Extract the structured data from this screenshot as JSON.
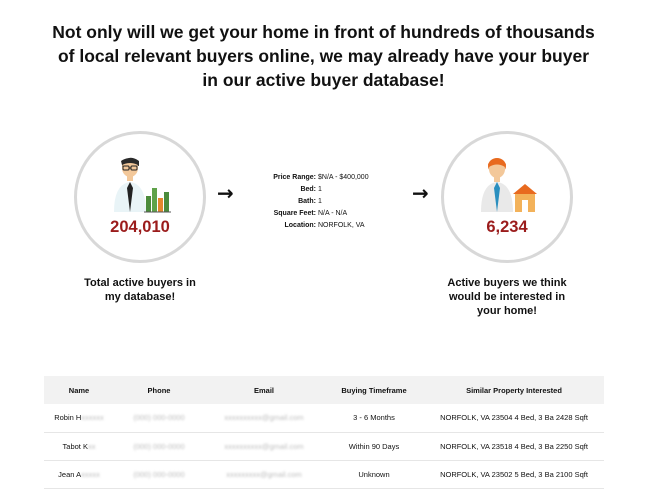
{
  "headline": {
    "line1": "Not only will we get your home in front of hundreds of thousands",
    "line2": "of local relevant buyers online, we may already have your buyer",
    "line3": "in our active buyer database!"
  },
  "left_stat": {
    "count": "204,010",
    "caption_line1": "Total active buyers in",
    "caption_line2": "my database!"
  },
  "right_stat": {
    "count": "6,234",
    "caption_line1": "Active buyers we think",
    "caption_line2": "would be interested in",
    "caption_line3": "your home!"
  },
  "criteria": [
    {
      "label": "Price Range:",
      "value": "$N/A - $400,000"
    },
    {
      "label": "Bed:",
      "value": "1"
    },
    {
      "label": "Bath:",
      "value": "1"
    },
    {
      "label": "Square Feet:",
      "value": "N/A - N/A"
    },
    {
      "label": "Location:",
      "value": "NORFOLK, VA"
    }
  ],
  "table": {
    "headers": [
      "Name",
      "Phone",
      "Email",
      "Buying Timeframe",
      "Similar Property Interested"
    ],
    "rows": [
      {
        "name_visible": "Robin H",
        "name_blurred": "xxxxxx",
        "phone": "(000) 000-0000",
        "email": "xxxxxxxxxx@gmail.com",
        "timeframe": "3 - 6 Months",
        "property": "NORFOLK, VA 23504 4 Bed, 3 Ba 2428 Sqft"
      },
      {
        "name_visible": "Tabot K",
        "name_blurred": "xx",
        "phone": "(000) 000-0000",
        "email": "xxxxxxxxxx@gmail.com",
        "timeframe": "Within 90 Days",
        "property": "NORFOLK, VA 23518 4 Bed, 3 Ba 2250 Sqft"
      },
      {
        "name_visible": "Jean A",
        "name_blurred": "xxxxx",
        "phone": "(000) 000-0000",
        "email": "xxxxxxxxx@gmail.com",
        "timeframe": "Unknown",
        "property": "NORFOLK, VA 23502 5 Bed, 3 Ba 2100 Sqft"
      }
    ]
  },
  "colors": {
    "count_red": "#9b1c1c",
    "circle_border": "#d8d8d8",
    "header_bg": "#f2f2f2"
  },
  "icons": [
    "businessman-chart-icon",
    "arrow-right-icon",
    "businessman-house-icon"
  ]
}
